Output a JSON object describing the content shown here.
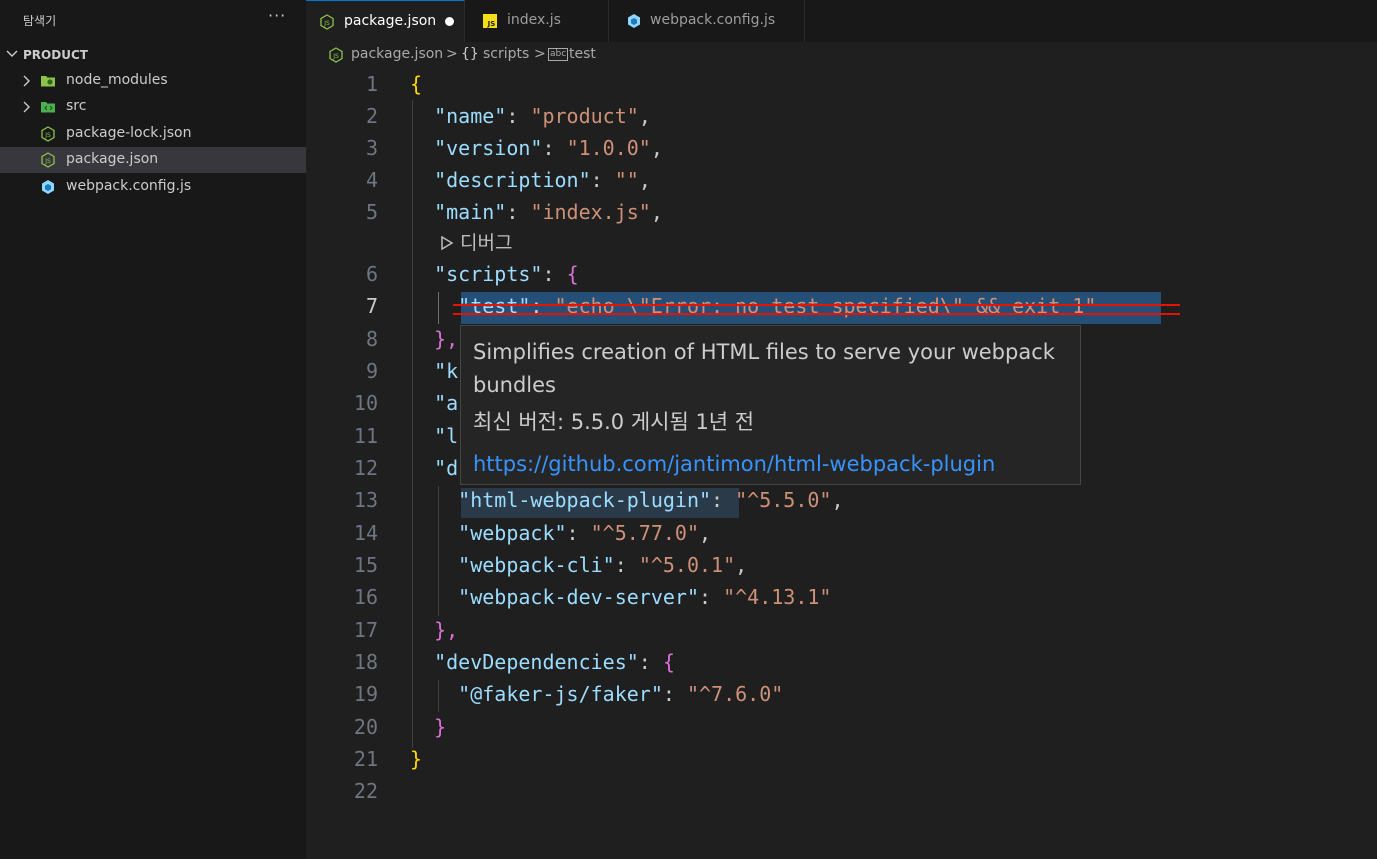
{
  "sidebar": {
    "title": "탐색기",
    "more": "···",
    "folder": "PRODUCT",
    "items": [
      {
        "label": "node_modules",
        "type": "folder"
      },
      {
        "label": "src",
        "type": "folder"
      },
      {
        "label": "package-lock.json",
        "type": "json"
      },
      {
        "label": "package.json",
        "type": "json",
        "selected": true
      },
      {
        "label": "webpack.config.js",
        "type": "webpack"
      }
    ]
  },
  "tabs": [
    {
      "label": "package.json",
      "icon": "json-icon",
      "active": true,
      "modified": true
    },
    {
      "label": "index.js",
      "icon": "js-icon"
    },
    {
      "label": "webpack.config.js",
      "icon": "webpack-icon"
    }
  ],
  "breadcrumb": {
    "file": "package.json",
    "section_icon": "{}",
    "section": "scripts",
    "leaf_icon": "abc",
    "leaf": "test",
    "separator": ">"
  },
  "editor": {
    "line_numbers": [
      "1",
      "2",
      "3",
      "4",
      "5",
      "6",
      "7",
      "8",
      "9",
      "10",
      "11",
      "12",
      "13",
      "14",
      "15",
      "16",
      "17",
      "18",
      "19",
      "20",
      "21",
      "22"
    ],
    "current_line": "7",
    "debug_codelens": "디버그",
    "lines": {
      "l1_brace": "{",
      "l2_key": "\"name\"",
      "l2_val": "\"product\"",
      "l3_key": "\"version\"",
      "l3_val": "\"1.0.0\"",
      "l4_key": "\"description\"",
      "l4_val": "\"\"",
      "l5_key": "\"main\"",
      "l5_val": "\"index.js\"",
      "l6_key": "\"scripts\"",
      "l6_brace": "{",
      "l7_key": "\"test\"",
      "l7_val": "\"echo \\\"Error: no test specified\\\" && exit 1\"",
      "l8_brace": "},",
      "l9_visible": "\"k",
      "l10_visible": "\"a",
      "l11_visible": "\"l",
      "l12_visible": "\"d",
      "l13_key": "\"html-webpack-plugin\"",
      "l13_val": "\"^5.5.0\"",
      "l14_key": "\"webpack\"",
      "l14_val": "\"^5.77.0\"",
      "l15_key": "\"webpack-cli\"",
      "l15_val": "\"^5.0.1\"",
      "l16_key": "\"webpack-dev-server\"",
      "l16_val": "\"^4.13.1\"",
      "l17_brace": "},",
      "l18_key": "\"devDependencies\"",
      "l18_brace": "{",
      "l19_key": "\"@faker-js/faker\"",
      "l19_val": "\"^7.6.0\"",
      "l20_brace": "}",
      "l21_brace": "}"
    }
  },
  "hover": {
    "description": "Simplifies creation of HTML files to serve your webpack bundles",
    "version_info": "최신 버전: 5.5.0 게시됨 1년 전",
    "link": "https://github.com/jantimon/html-webpack-plugin"
  },
  "colors": {
    "background": "#1f1f1f",
    "sidebar": "#181818",
    "key": "#9cdcfe",
    "string": "#ce9178",
    "bracket_level1": "#ffd700",
    "bracket_level2": "#da70d6",
    "selection": "#264f78",
    "strikethrough": "#e51400",
    "link": "#3794ff"
  }
}
